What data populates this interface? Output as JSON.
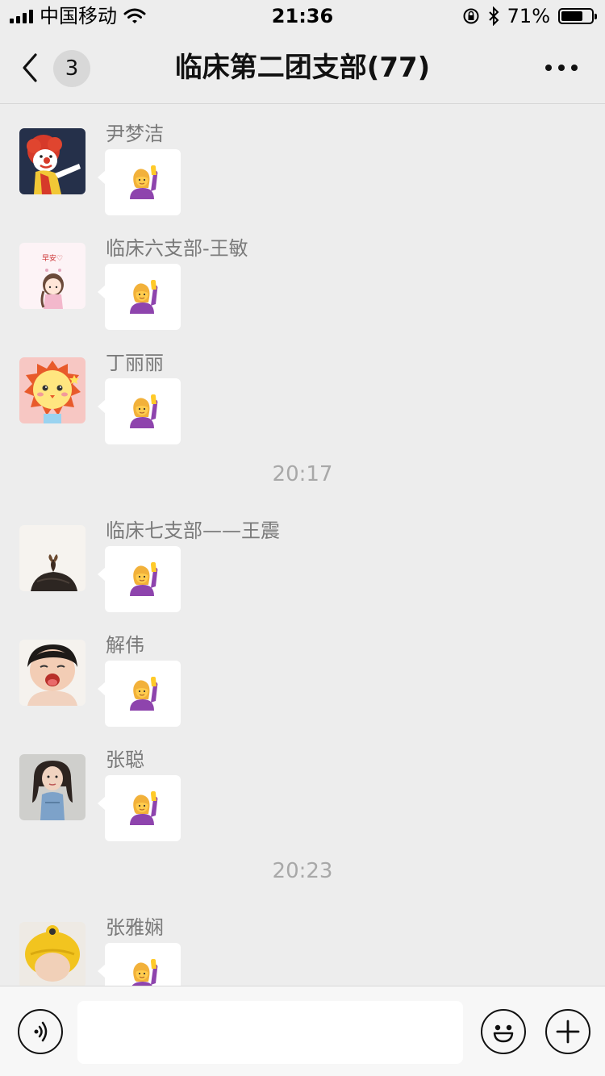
{
  "status_bar": {
    "carrier": "中国移动",
    "time": "21:36",
    "battery": "71%",
    "battery_level": 0.71,
    "icons": [
      "signal-icon",
      "wifi-icon",
      "orientation-lock-icon",
      "bluetooth-icon",
      "battery-icon"
    ]
  },
  "nav": {
    "unread_count": "3",
    "title": "临床第二团支部(77)",
    "icons": [
      "back-chevron-icon",
      "more-dots-icon"
    ]
  },
  "messages": [
    {
      "type": "message",
      "sender": "尹梦洁",
      "content_icon": "raising-hand-emoji",
      "avatar": "clown-avatar"
    },
    {
      "type": "message",
      "sender": "临床六支部-王敏",
      "content_icon": "raising-hand-emoji",
      "avatar": "cartoon-girl-avatar"
    },
    {
      "type": "message",
      "sender": "丁丽丽",
      "content_icon": "raising-hand-emoji",
      "avatar": "lion-avatar"
    },
    {
      "type": "time",
      "text": "20:17"
    },
    {
      "type": "message",
      "sender": "临床七支部——王震",
      "content_icon": "raising-hand-emoji",
      "avatar": "hair-bun-avatar"
    },
    {
      "type": "message",
      "sender": "解伟",
      "content_icon": "raising-hand-emoji",
      "avatar": "crying-baby-avatar"
    },
    {
      "type": "message",
      "sender": "张聪",
      "content_icon": "raising-hand-emoji",
      "avatar": "girl-photo-avatar"
    },
    {
      "type": "time",
      "text": "20:23"
    },
    {
      "type": "message",
      "sender": "张雅娴",
      "content_icon": "raising-hand-emoji",
      "avatar": "yellow-hat-avatar"
    }
  ],
  "input_bar": {
    "value": "",
    "icons": [
      "voice-icon",
      "emoji-face-icon",
      "plus-icon"
    ]
  },
  "colors": {
    "background": "#ededed",
    "bubble": "#ffffff",
    "name_text": "#7a7a7a",
    "timestamp_text": "#a8a8a8"
  }
}
